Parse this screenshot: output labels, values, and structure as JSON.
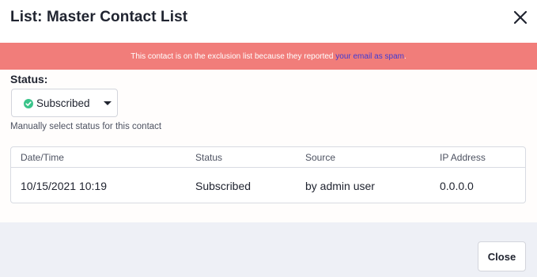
{
  "modal": {
    "title": "List: Master Contact List",
    "close_icon": "close-icon"
  },
  "banner": {
    "text": "This contact is on the exclusion list because they reported ",
    "link_text": "your email as spam",
    "suffix": ".",
    "background": "#f17d7a",
    "link_color": "#3f3bd4"
  },
  "status": {
    "label": "Status:",
    "selected": "Subscribed",
    "icon": "check-circle-icon",
    "icon_color": "#3ac48a",
    "help": "Manually select status for this contact"
  },
  "table": {
    "headers": [
      "Date/Time",
      "Status",
      "Source",
      "IP Address"
    ],
    "rows": [
      [
        "10/15/2021 10:19",
        "Subscribed",
        "by admin user",
        "0.0.0.0"
      ]
    ]
  },
  "footer": {
    "close_label": "Close"
  }
}
